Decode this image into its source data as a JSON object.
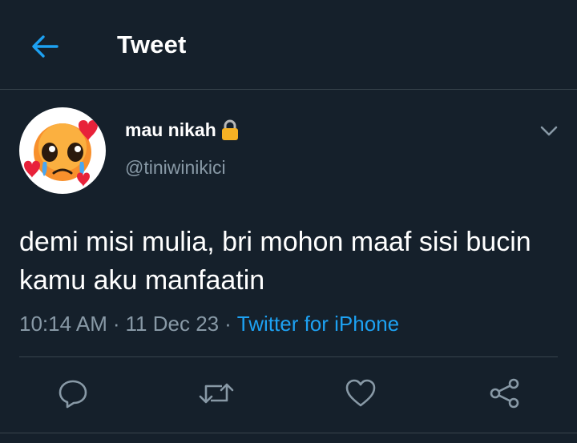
{
  "header": {
    "back_icon": "arrow-left-icon",
    "title": "Tweet"
  },
  "tweet": {
    "avatar_icon": "pleading-face-with-hearts-emoji",
    "display_name": "mau nikah",
    "lock_icon": "lock-icon",
    "handle": "@tiniwinikici",
    "more_icon": "chevron-down-icon",
    "text": "demi misi mulia, bri mohon maaf sisi bucin kamu aku manfaatin",
    "time": "10:14 AM",
    "date": "11 Dec 23",
    "separator": "·",
    "source": "Twitter for iPhone"
  },
  "actions": {
    "reply_icon": "reply-icon",
    "retweet_icon": "retweet-icon",
    "like_icon": "heart-icon",
    "share_icon": "share-icon"
  },
  "colors": {
    "background": "#15202b",
    "accent": "#1da1f2",
    "secondary_text": "#8899a6",
    "divider": "#38444d",
    "icon": "#8899a6"
  }
}
